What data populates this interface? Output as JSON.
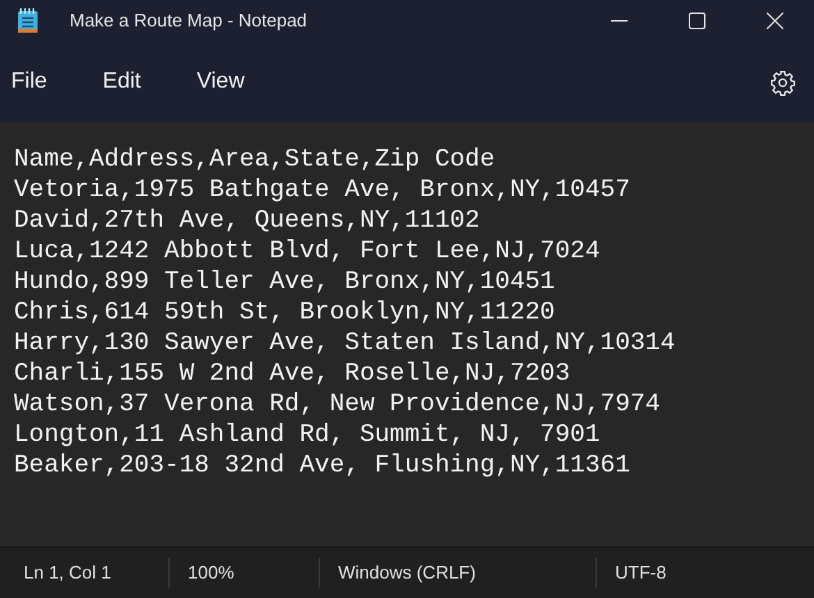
{
  "window": {
    "title": "Make a Route Map - Notepad"
  },
  "menu": [
    "File",
    "Edit",
    "View"
  ],
  "lines": [
    "Name,Address,Area,State,Zip Code",
    "Vetoria,1975 Bathgate Ave, Bronx,NY,10457",
    "David,27th Ave, Queens,NY,11102",
    "Luca,1242 Abbott Blvd, Fort Lee,NJ,7024",
    "Hundo,899 Teller Ave, Bronx,NY,10451",
    "Chris,614 59th St, Brooklyn,NY,11220",
    "Harry,130 Sawyer Ave, Staten Island,NY,10314",
    "Charli,155 W 2nd Ave, Roselle,NJ,7203",
    "Watson,37 Verona Rd, New Providence,NJ,7974",
    "Longton,11 Ashland Rd, Summit, NJ, 7901",
    "Beaker,203-18 32nd Ave, Flushing,NY,11361"
  ],
  "status_bar": [
    "Ln 1, Col 1",
    "100%",
    "Windows (CRLF)",
    "UTF-8"
  ]
}
